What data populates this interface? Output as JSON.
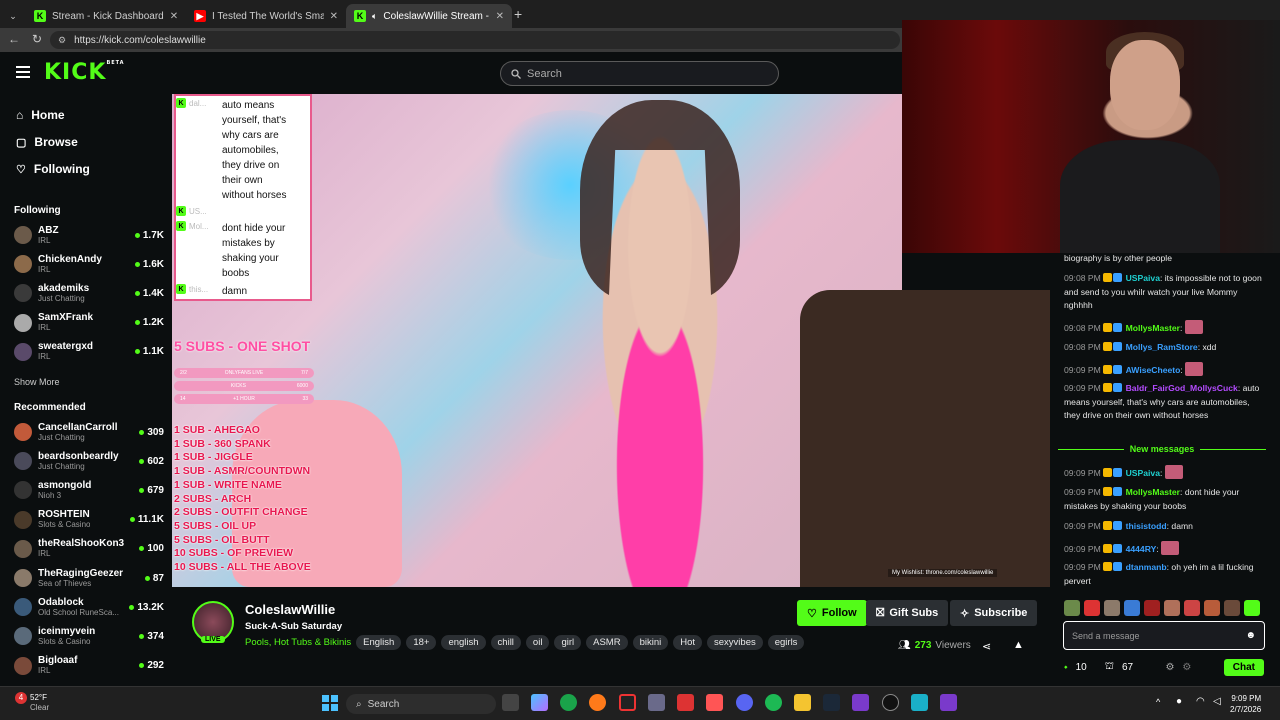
{
  "browser": {
    "tabs": [
      {
        "label": "Stream - Kick Dashboard",
        "favicon": "kick-icon",
        "color": "#53fc18"
      },
      {
        "label": "I Tested The World's Smartest Ape",
        "favicon": "youtube-icon",
        "color": "#ff0000"
      },
      {
        "label": "ColeslawWillie Stream - Watch",
        "favicon": "kick-icon",
        "color": "#53fc18"
      }
    ],
    "url": "https://kick.com/coleslawwillie"
  },
  "header": {
    "logo": "KICK",
    "logo_sup": "BETA",
    "search_placeholder": "Search"
  },
  "sidebar": {
    "nav": [
      {
        "label": "Home"
      },
      {
        "label": "Browse"
      },
      {
        "label": "Following"
      }
    ],
    "following_title": "Following",
    "following": [
      {
        "name": "ABZ",
        "cat": "IRL",
        "viewers": "1.7K"
      },
      {
        "name": "ChickenAndy",
        "cat": "IRL",
        "viewers": "1.6K"
      },
      {
        "name": "akademiks",
        "cat": "Just Chatting",
        "viewers": "1.4K"
      },
      {
        "name": "SamXFrank",
        "cat": "IRL",
        "viewers": "1.2K"
      },
      {
        "name": "sweatergxd",
        "cat": "IRL",
        "viewers": "1.1K"
      }
    ],
    "show_more": "Show More",
    "recommended_title": "Recommended",
    "recommended": [
      {
        "name": "CancelIanCarroll",
        "cat": "Just Chatting",
        "viewers": "309"
      },
      {
        "name": "beardsonbeardly",
        "cat": "Just Chatting",
        "viewers": "602"
      },
      {
        "name": "asmongold",
        "cat": "Nioh 3",
        "viewers": "679"
      },
      {
        "name": "ROSHTEIN",
        "cat": "Slots & Casino",
        "viewers": "11.1K"
      },
      {
        "name": "theRealShooKon3",
        "cat": "IRL",
        "viewers": "100"
      },
      {
        "name": "TheRagingGeezer",
        "cat": "Sea of Thieves",
        "viewers": "87"
      },
      {
        "name": "Odablock",
        "cat": "Old School RuneSca...",
        "viewers": "13.2K"
      },
      {
        "name": "iceinmyvein",
        "cat": "Slots & Casino",
        "viewers": "374"
      },
      {
        "name": "Bigloaaf",
        "cat": "IRL",
        "viewers": "292"
      }
    ]
  },
  "overlay": {
    "chat": [
      {
        "name": "dal...",
        "lines": [
          "auto means",
          "yourself, that's",
          "why cars are",
          "automobiles,",
          "they drive on",
          "their own",
          "without horses"
        ]
      },
      {
        "name": "US...",
        "lines": []
      },
      {
        "name": "Mol...",
        "lines": [
          "dont hide your",
          "mistakes by",
          "shaking your",
          "boobs"
        ]
      },
      {
        "name": "this...",
        "lines": [
          "damn"
        ]
      }
    ],
    "subs_title": "5 SUBS - ONE SHOT",
    "table_rows": [
      {
        "left": "2/2",
        "mid": "ONLYFANS LIVE",
        "right": "7/7"
      },
      {
        "left": "",
        "mid": "KICKS",
        "right": "6000"
      },
      {
        "left": "14",
        "mid": "+1 HOUR",
        "right": "33"
      }
    ],
    "menu": [
      "1 SUB - AHEGAO",
      "1 SUB - 360 SPANK",
      "1 SUB - JIGGLE",
      "1 SUB - ASMR/COUNTDWN",
      "1 SUB - WRITE NAME",
      "2 SUBS - ARCH",
      "2 SUBS - OUTFIT CHANGE",
      "5 SUBS -  OIL UP",
      "5 SUBS - OIL BUTT",
      "10 SUBS - OF PREVIEW",
      "10 SUBS - ALL THE ABOVE"
    ],
    "wishlist": "My Wishlist: throne.com/coleslawwillie"
  },
  "stream": {
    "name": "ColeslawWillie",
    "live": "LIVE",
    "title": "Suck-A-Sub Saturday",
    "category": "Pools, Hot Tubs & Bikinis",
    "tags": [
      "English",
      "18+",
      "english",
      "chill",
      "oil",
      "girl",
      "ASMR",
      "bikini",
      "Hot",
      "sexyvibes",
      "egirls"
    ],
    "follow": "Follow",
    "gift": "Gift Subs",
    "subscribe": "Subscribe",
    "viewers_count": "273",
    "viewers_label": "Viewers"
  },
  "chat": {
    "messages": [
      {
        "time": "",
        "user": "",
        "user_color": "#ffffff",
        "text": "biography is by other people"
      },
      {
        "time": "09:08 PM",
        "user": "USPaiva",
        "user_color": "#1fd1d1",
        "text": "its impossible not to goon and send to you whilr watch your live Mommy nghhhh"
      },
      {
        "time": "09:08 PM",
        "user": "MollysMaster",
        "user_color": "#53fc18",
        "text": ""
      },
      {
        "time": "09:08 PM",
        "user": "Mollys_RamStore",
        "user_color": "#3aa0ff",
        "text": "xdd"
      },
      {
        "time": "09:09 PM",
        "user": "AWiseCheeto",
        "user_color": "#3aa0ff",
        "text": ""
      },
      {
        "time": "09:09 PM",
        "user": "Baldr_FairGod_MollysCuck",
        "user_color": "#b44cff",
        "text": "auto means yourself, that's why cars are automobiles, they drive on their own without horses"
      }
    ],
    "new_messages": "New messages",
    "messages2": [
      {
        "time": "09:09 PM",
        "user": "USPaiva",
        "user_color": "#1fd1d1",
        "text": ""
      },
      {
        "time": "09:09 PM",
        "user": "MollysMaster",
        "user_color": "#53fc18",
        "text": "dont hide your mistakes by shaking your boobs"
      },
      {
        "time": "09:09 PM",
        "user": "thisistodd",
        "user_color": "#3aa0ff",
        "text": "damn"
      },
      {
        "time": "09:09 PM",
        "user": "4444RY",
        "user_color": "#3aa0ff",
        "text": ""
      },
      {
        "time": "09:09 PM",
        "user": "dtanmanb",
        "user_color": "#3aa0ff",
        "text": "oh yeh im a lil fucking pervert"
      }
    ],
    "input_placeholder": "Send a message",
    "points": "10",
    "subs": "67",
    "chat_button": "Chat"
  },
  "taskbar": {
    "weather_temp": "52°F",
    "weather_desc": "Clear",
    "search": "Search",
    "time": "9:09 PM",
    "date": "2/7/2026"
  },
  "colors": {
    "accent": "#53fc18",
    "bg": "#0b0e0f",
    "panel": "#191b1f"
  }
}
